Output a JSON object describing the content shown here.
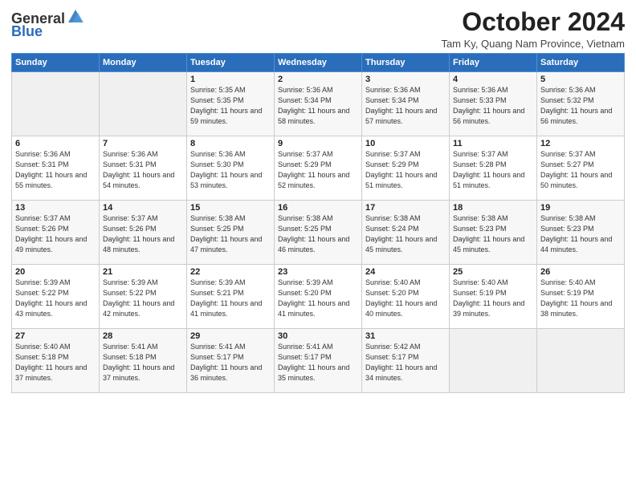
{
  "logo": {
    "general": "General",
    "blue": "Blue"
  },
  "title": "October 2024",
  "location": "Tam Ky, Quang Nam Province, Vietnam",
  "headers": [
    "Sunday",
    "Monday",
    "Tuesday",
    "Wednesday",
    "Thursday",
    "Friday",
    "Saturday"
  ],
  "weeks": [
    [
      {
        "day": "",
        "info": ""
      },
      {
        "day": "",
        "info": ""
      },
      {
        "day": "1",
        "info": "Sunrise: 5:35 AM\nSunset: 5:35 PM\nDaylight: 11 hours and 59 minutes."
      },
      {
        "day": "2",
        "info": "Sunrise: 5:36 AM\nSunset: 5:34 PM\nDaylight: 11 hours and 58 minutes."
      },
      {
        "day": "3",
        "info": "Sunrise: 5:36 AM\nSunset: 5:34 PM\nDaylight: 11 hours and 57 minutes."
      },
      {
        "day": "4",
        "info": "Sunrise: 5:36 AM\nSunset: 5:33 PM\nDaylight: 11 hours and 56 minutes."
      },
      {
        "day": "5",
        "info": "Sunrise: 5:36 AM\nSunset: 5:32 PM\nDaylight: 11 hours and 56 minutes."
      }
    ],
    [
      {
        "day": "6",
        "info": "Sunrise: 5:36 AM\nSunset: 5:31 PM\nDaylight: 11 hours and 55 minutes."
      },
      {
        "day": "7",
        "info": "Sunrise: 5:36 AM\nSunset: 5:31 PM\nDaylight: 11 hours and 54 minutes."
      },
      {
        "day": "8",
        "info": "Sunrise: 5:36 AM\nSunset: 5:30 PM\nDaylight: 11 hours and 53 minutes."
      },
      {
        "day": "9",
        "info": "Sunrise: 5:37 AM\nSunset: 5:29 PM\nDaylight: 11 hours and 52 minutes."
      },
      {
        "day": "10",
        "info": "Sunrise: 5:37 AM\nSunset: 5:29 PM\nDaylight: 11 hours and 51 minutes."
      },
      {
        "day": "11",
        "info": "Sunrise: 5:37 AM\nSunset: 5:28 PM\nDaylight: 11 hours and 51 minutes."
      },
      {
        "day": "12",
        "info": "Sunrise: 5:37 AM\nSunset: 5:27 PM\nDaylight: 11 hours and 50 minutes."
      }
    ],
    [
      {
        "day": "13",
        "info": "Sunrise: 5:37 AM\nSunset: 5:26 PM\nDaylight: 11 hours and 49 minutes."
      },
      {
        "day": "14",
        "info": "Sunrise: 5:37 AM\nSunset: 5:26 PM\nDaylight: 11 hours and 48 minutes."
      },
      {
        "day": "15",
        "info": "Sunrise: 5:38 AM\nSunset: 5:25 PM\nDaylight: 11 hours and 47 minutes."
      },
      {
        "day": "16",
        "info": "Sunrise: 5:38 AM\nSunset: 5:25 PM\nDaylight: 11 hours and 46 minutes."
      },
      {
        "day": "17",
        "info": "Sunrise: 5:38 AM\nSunset: 5:24 PM\nDaylight: 11 hours and 45 minutes."
      },
      {
        "day": "18",
        "info": "Sunrise: 5:38 AM\nSunset: 5:23 PM\nDaylight: 11 hours and 45 minutes."
      },
      {
        "day": "19",
        "info": "Sunrise: 5:38 AM\nSunset: 5:23 PM\nDaylight: 11 hours and 44 minutes."
      }
    ],
    [
      {
        "day": "20",
        "info": "Sunrise: 5:39 AM\nSunset: 5:22 PM\nDaylight: 11 hours and 43 minutes."
      },
      {
        "day": "21",
        "info": "Sunrise: 5:39 AM\nSunset: 5:22 PM\nDaylight: 11 hours and 42 minutes."
      },
      {
        "day": "22",
        "info": "Sunrise: 5:39 AM\nSunset: 5:21 PM\nDaylight: 11 hours and 41 minutes."
      },
      {
        "day": "23",
        "info": "Sunrise: 5:39 AM\nSunset: 5:20 PM\nDaylight: 11 hours and 41 minutes."
      },
      {
        "day": "24",
        "info": "Sunrise: 5:40 AM\nSunset: 5:20 PM\nDaylight: 11 hours and 40 minutes."
      },
      {
        "day": "25",
        "info": "Sunrise: 5:40 AM\nSunset: 5:19 PM\nDaylight: 11 hours and 39 minutes."
      },
      {
        "day": "26",
        "info": "Sunrise: 5:40 AM\nSunset: 5:19 PM\nDaylight: 11 hours and 38 minutes."
      }
    ],
    [
      {
        "day": "27",
        "info": "Sunrise: 5:40 AM\nSunset: 5:18 PM\nDaylight: 11 hours and 37 minutes."
      },
      {
        "day": "28",
        "info": "Sunrise: 5:41 AM\nSunset: 5:18 PM\nDaylight: 11 hours and 37 minutes."
      },
      {
        "day": "29",
        "info": "Sunrise: 5:41 AM\nSunset: 5:17 PM\nDaylight: 11 hours and 36 minutes."
      },
      {
        "day": "30",
        "info": "Sunrise: 5:41 AM\nSunset: 5:17 PM\nDaylight: 11 hours and 35 minutes."
      },
      {
        "day": "31",
        "info": "Sunrise: 5:42 AM\nSunset: 5:17 PM\nDaylight: 11 hours and 34 minutes."
      },
      {
        "day": "",
        "info": ""
      },
      {
        "day": "",
        "info": ""
      }
    ]
  ]
}
